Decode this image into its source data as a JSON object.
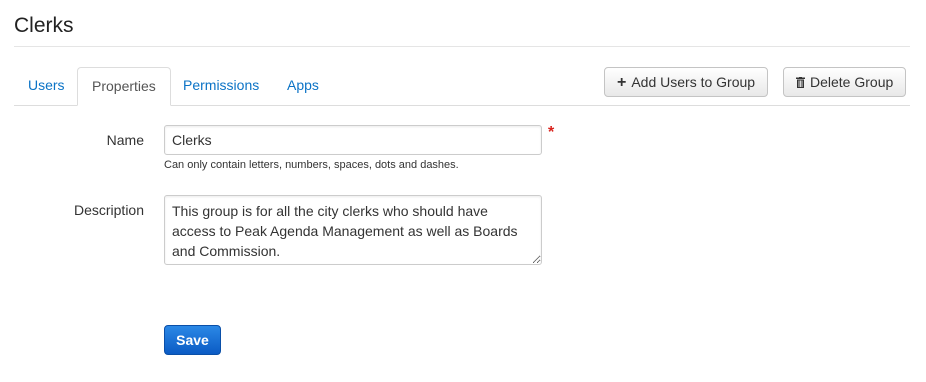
{
  "page": {
    "title": "Clerks"
  },
  "tabs": [
    {
      "label": "Users",
      "active": false
    },
    {
      "label": "Properties",
      "active": true
    },
    {
      "label": "Permissions",
      "active": false
    },
    {
      "label": "Apps",
      "active": false
    }
  ],
  "actions": {
    "add_users_label": "Add Users to Group",
    "add_users_icon": "plus-icon",
    "delete_group_label": "Delete Group",
    "delete_group_icon": "trash-icon"
  },
  "form": {
    "name": {
      "label": "Name",
      "value": "Clerks",
      "required_marker": "*",
      "hint": "Can only contain letters, numbers, spaces, dots and dashes."
    },
    "description": {
      "label": "Description",
      "value": "This group is for all the city clerks who should have access to Peak Agenda Management as well as Boards and Commission."
    },
    "save_label": "Save"
  },
  "colors": {
    "link": "#0b73c6",
    "primary": "#0b5bc4",
    "required": "#d9231d"
  }
}
